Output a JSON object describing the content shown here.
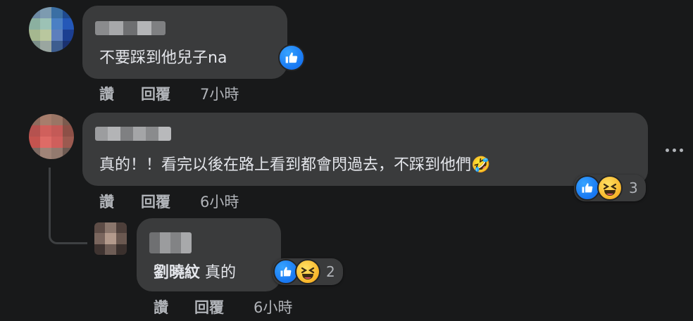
{
  "comments": [
    {
      "text": "不要踩到他兒子na",
      "actions": {
        "like": "讚",
        "reply": "回覆",
        "time": "7小時"
      }
    },
    {
      "text": "真的！！看完以後在路上看到都會閃過去，不踩到他們🤣",
      "reaction_count": "3",
      "actions": {
        "like": "讚",
        "reply": "回覆",
        "time": "6小時"
      }
    },
    {
      "mention": "劉曉紋",
      "text": "真的",
      "reaction_count": "2",
      "actions": {
        "like": "讚",
        "reply": "回覆",
        "time": "6小時"
      }
    }
  ],
  "icons": {
    "like": "thumbs-up-icon",
    "haha": "laughing-emoji-icon",
    "more": "more-options-icon"
  },
  "colors": {
    "background": "#18191a",
    "bubble": "#3a3b3c",
    "like_blue": "#1877f2",
    "haha_yellow": "#f7b125",
    "secondary_text": "#b0b3b8"
  }
}
